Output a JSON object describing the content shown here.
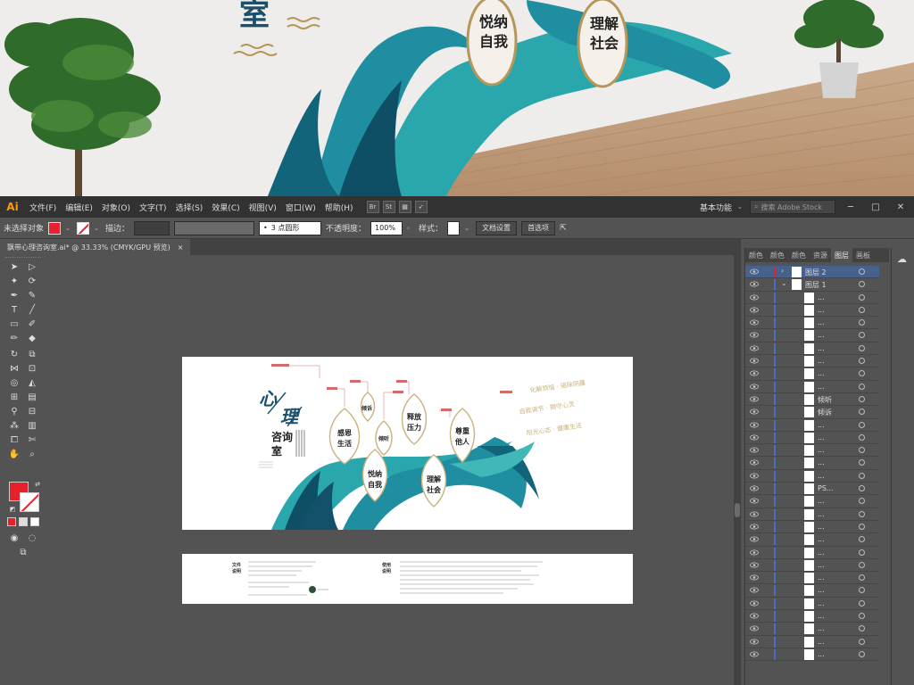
{
  "photo": {
    "wall_title_partial": "室",
    "bubbles": [
      {
        "text": "悦纳\n自我"
      },
      {
        "text": "理解\n社会"
      }
    ]
  },
  "app": {
    "logo": "Ai",
    "menu": [
      "文件(F)",
      "编辑(E)",
      "对象(O)",
      "文字(T)",
      "选择(S)",
      "效果(C)",
      "视图(V)",
      "窗口(W)",
      "帮助(H)"
    ],
    "workspace": "基本功能",
    "search_placeholder": "搜索 Adobe Stock",
    "app_icon_labels": [
      "Br",
      "St"
    ]
  },
  "control_bar": {
    "selection": "未选择对象",
    "stroke_label": "描边：",
    "stroke_weight": "",
    "brush_value": "3 点圆形",
    "opacity_label": "不透明度：",
    "opacity_value": "100%",
    "style_label": "样式：",
    "doc_setup": "文档设置",
    "preferences": "首选项"
  },
  "document_tab": {
    "title": "飘带心理咨询室.ai* @ 33.33% (CMYK/GPU 预览)",
    "close": "×"
  },
  "panel": {
    "tabs": [
      "颜色",
      "颜色",
      "颜色",
      "资源",
      "图层",
      "画板"
    ],
    "active_tab": "图层",
    "layers": [
      {
        "name": "图层 2",
        "thumb": false,
        "expanded": false
      },
      {
        "name": "图层 1",
        "thumb": false,
        "expanded": true
      },
      {
        "name": "...",
        "thumb": true
      },
      {
        "name": "...",
        "thumb": true
      },
      {
        "name": "...",
        "thumb": true
      },
      {
        "name": "...",
        "thumb": true
      },
      {
        "name": "...",
        "thumb": true
      },
      {
        "name": "...",
        "thumb": true
      },
      {
        "name": "...",
        "thumb": true
      },
      {
        "name": "...",
        "thumb": true
      },
      {
        "name": "倾听",
        "thumb": true
      },
      {
        "name": "倾诉",
        "thumb": true
      },
      {
        "name": "...",
        "thumb": true
      },
      {
        "name": "...",
        "thumb": true
      },
      {
        "name": "...",
        "thumb": true
      },
      {
        "name": "...",
        "thumb": true
      },
      {
        "name": "...",
        "thumb": true
      },
      {
        "name": "PS...",
        "thumb": true
      },
      {
        "name": "...",
        "thumb": true
      },
      {
        "name": "...",
        "thumb": true
      },
      {
        "name": "...",
        "thumb": true
      },
      {
        "name": "...",
        "thumb": true
      },
      {
        "name": "...",
        "thumb": true
      },
      {
        "name": "...",
        "thumb": true
      },
      {
        "name": "...",
        "thumb": true
      },
      {
        "name": "...",
        "thumb": true
      },
      {
        "name": "...",
        "thumb": true
      },
      {
        "name": "...",
        "thumb": true
      },
      {
        "name": "...",
        "thumb": true
      },
      {
        "name": "...",
        "thumb": true
      },
      {
        "name": "...",
        "thumb": true
      }
    ]
  },
  "artboard": {
    "title1": "心",
    "title2": "理",
    "subtitle": "咨询室",
    "leaves": [
      "感恩\n生活",
      "倾诉",
      "倾听",
      "释放\n压力",
      "尊重\n他人",
      "悦纳\n自我",
      "理解\n社会"
    ],
    "side_text": [
      "化解烦恼 · 驱除阴霾",
      "自我调节 · 撷守心灵",
      "阳光心态 · 健康生活"
    ]
  },
  "artboard2": {
    "label_left": "文件\n说明",
    "label_right": "使用\n说明"
  },
  "colors": {
    "accent_teal": "#1f9a9a",
    "dark_teal": "#13506b",
    "gold": "#b6975a",
    "fill_red": "#e8202a",
    "chrome": "#535353"
  }
}
